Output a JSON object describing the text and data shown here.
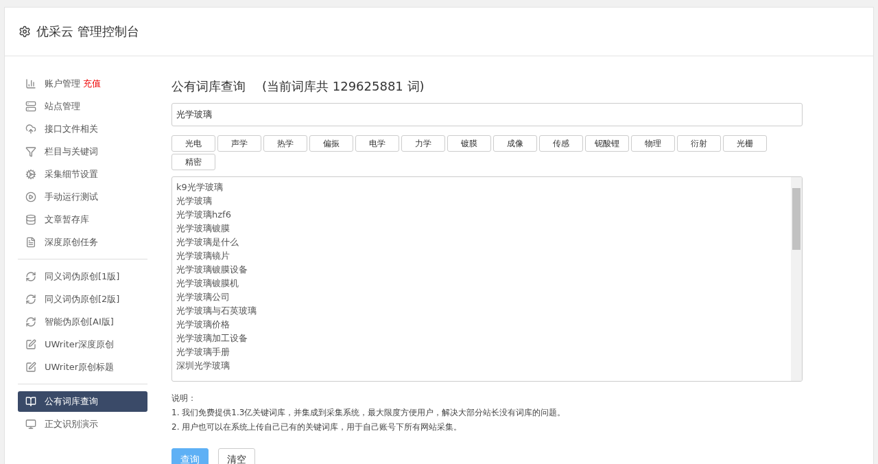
{
  "header": {
    "title": "优采云 管理控制台"
  },
  "sidebar": {
    "groups": [
      {
        "items": [
          {
            "kind": "chart",
            "label": "账户管理",
            "badge": "充值",
            "selected": false
          },
          {
            "kind": "server",
            "label": "站点管理",
            "selected": false
          },
          {
            "kind": "cloud",
            "label": "接口文件相关",
            "selected": false
          },
          {
            "kind": "filter",
            "label": "栏目与关键词",
            "selected": false
          },
          {
            "kind": "cogs",
            "label": "采集细节设置",
            "selected": false
          },
          {
            "kind": "play",
            "label": "手动运行测试",
            "selected": false
          },
          {
            "kind": "database",
            "label": "文章暂存库",
            "selected": false
          },
          {
            "kind": "doc",
            "label": "深度原创任务",
            "selected": false
          }
        ]
      },
      {
        "items": [
          {
            "kind": "refresh",
            "label": "同义词伪原创[1版]",
            "selected": false
          },
          {
            "kind": "refresh",
            "label": "同义词伪原创[2版]",
            "selected": false
          },
          {
            "kind": "refresh",
            "label": "智能伪原创[AI版]",
            "selected": false
          },
          {
            "kind": "edit",
            "label": "UWriter深度原创",
            "selected": false
          },
          {
            "kind": "edit",
            "label": "UWriter原创标题",
            "selected": false
          }
        ]
      },
      {
        "items": [
          {
            "kind": "book",
            "label": "公有词库查询",
            "selected": true
          },
          {
            "kind": "monitor",
            "label": "正文识别演示",
            "selected": false
          }
        ]
      }
    ]
  },
  "main": {
    "title": "公有词库查询",
    "subtitle": "(当前词库共 129625881 词)",
    "search": {
      "value": "光学玻璃"
    },
    "tags": [
      "光电",
      "声学",
      "热学",
      "偏振",
      "电学",
      "力学",
      "镀膜",
      "成像",
      "传感",
      "铌酸锂",
      "物理",
      "衍射",
      "光栅",
      "精密"
    ],
    "results": [
      "k9光学玻璃",
      "光学玻璃",
      "光学玻璃hzf6",
      "光学玻璃镀膜",
      "光学玻璃是什么",
      "光学玻璃镜片",
      "光学玻璃镀膜设备",
      "光学玻璃镀膜机",
      "光学玻璃公司",
      "光学玻璃与石英玻璃",
      "光学玻璃价格",
      "光学玻璃加工设备",
      "光学玻璃手册",
      "深圳光学玻璃"
    ],
    "notes": {
      "heading": "说明：",
      "lines": [
        "1. 我们免费提供1.3亿关键词库，并集成到采集系统，最大限度方便用户，解决大部分站长没有词库的问题。",
        "2. 用户也可以在系统上传自己已有的关键词库，用于自己账号下所有网站采集。"
      ]
    },
    "buttons": [
      {
        "kind": "primary",
        "label": "查询"
      },
      {
        "kind": "default",
        "label": "清空"
      }
    ]
  }
}
